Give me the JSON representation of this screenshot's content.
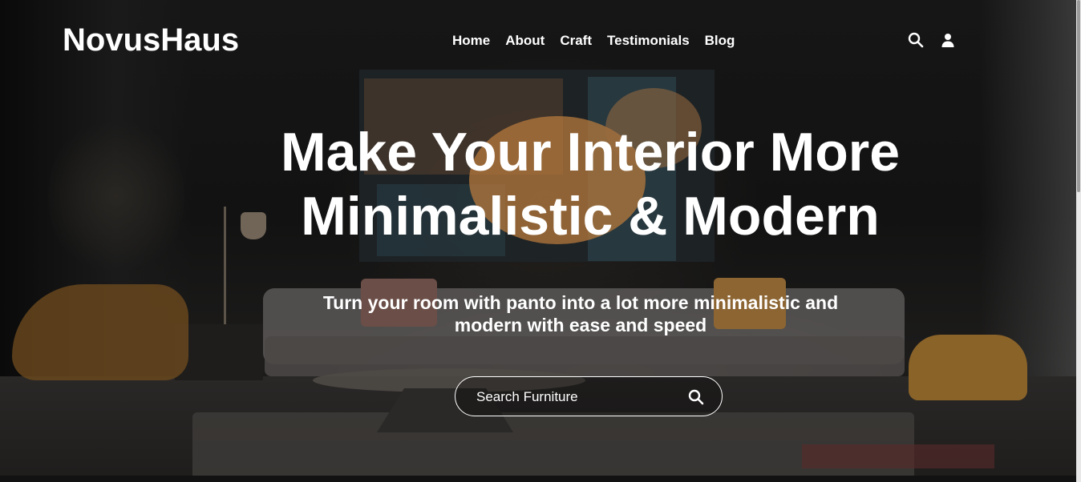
{
  "brand": {
    "logo_text": "NovusHaus"
  },
  "nav": {
    "items": [
      {
        "label": "Home"
      },
      {
        "label": "About"
      },
      {
        "label": "Craft"
      },
      {
        "label": "Testimonials"
      },
      {
        "label": "Blog"
      }
    ],
    "icons": [
      "search-icon",
      "user-icon"
    ]
  },
  "hero": {
    "title_line1": "Make Your Interior More",
    "title_line2": "Minimalistic & Modern",
    "subtitle_line1": "Turn your room with panto into a lot more minimalistic and",
    "subtitle_line2": "modern with ease and speed",
    "search": {
      "placeholder": "Search Furniture",
      "value": ""
    }
  },
  "colors": {
    "text": "#ffffff",
    "background": "#121212"
  }
}
